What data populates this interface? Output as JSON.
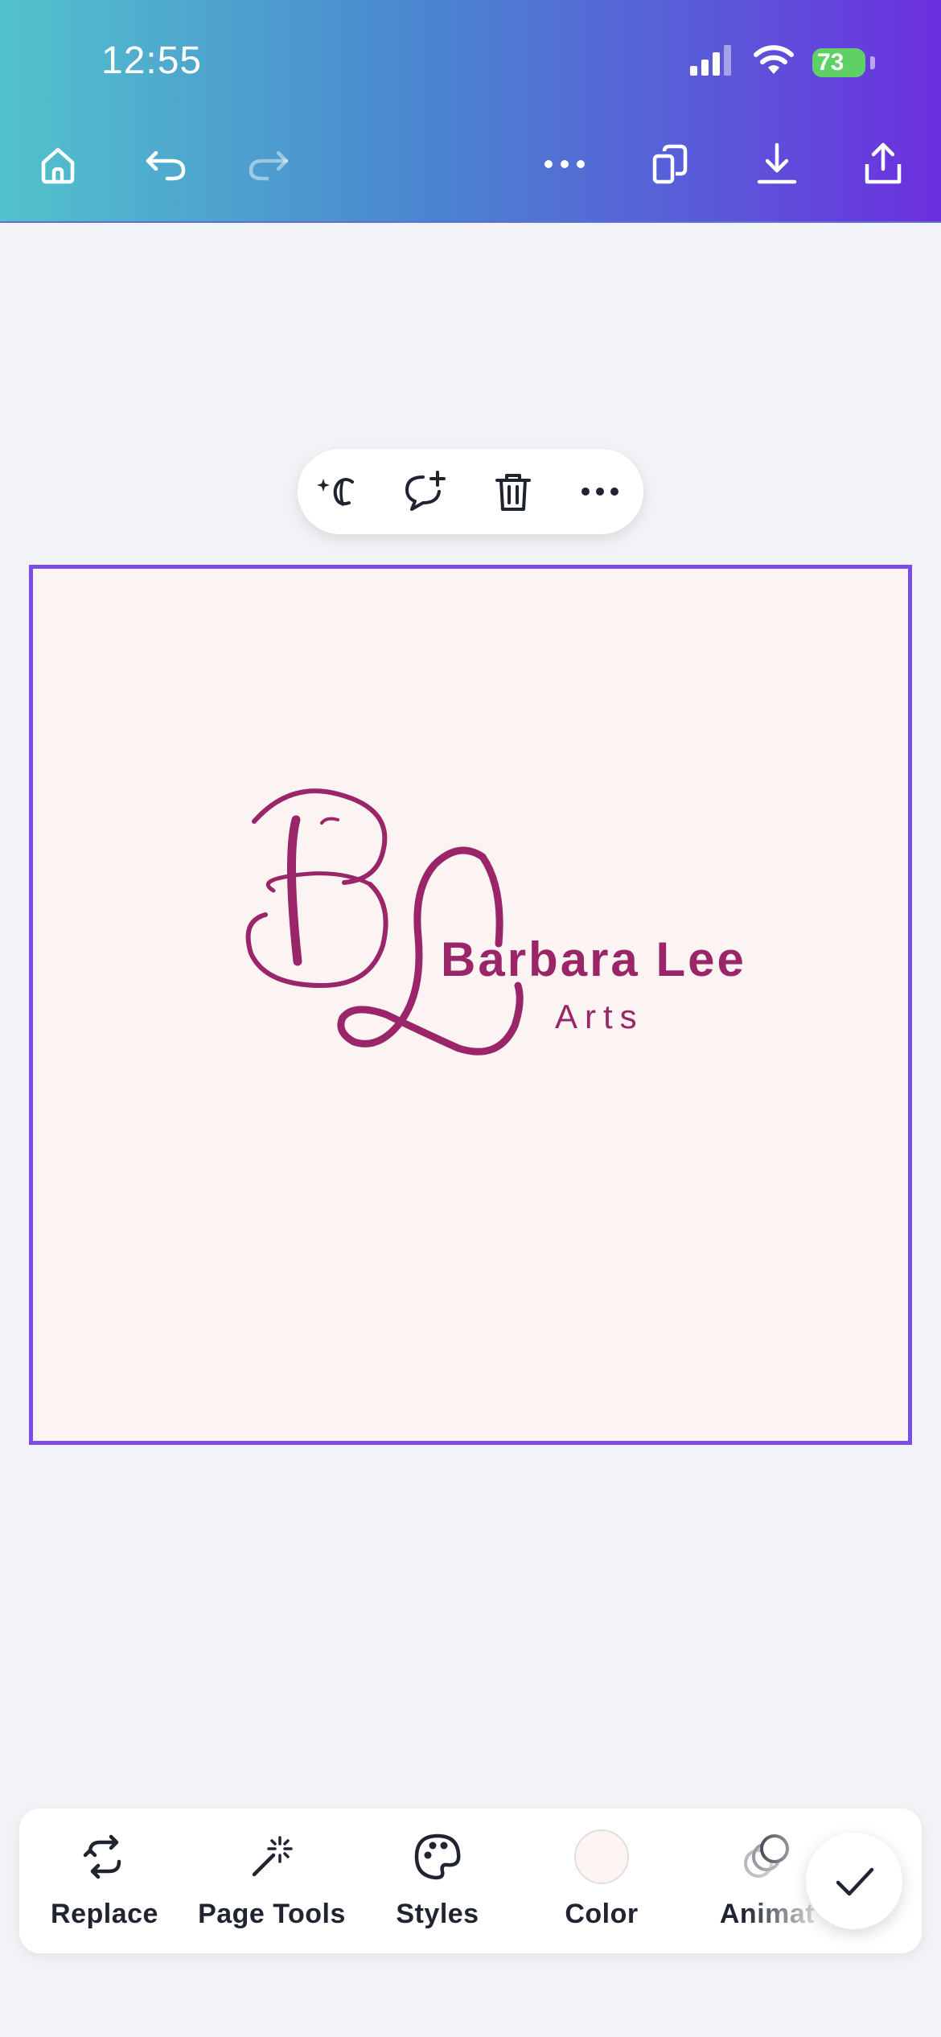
{
  "status_bar": {
    "time": "12:55",
    "battery_percent": "73"
  },
  "top_toolbar": {
    "icons": [
      "home-icon",
      "undo-icon",
      "redo-icon",
      "more-icon",
      "copy-pages-icon",
      "download-icon",
      "share-icon"
    ]
  },
  "floating_toolbar": {
    "icons": [
      "magic-edit-icon",
      "add-comment-icon",
      "delete-icon",
      "more-icon"
    ]
  },
  "design": {
    "background_color": "#fcf4f2",
    "brand_color": "#9a2568",
    "monogram": "BL",
    "name": "Barbara Lee",
    "subtitle": "Arts"
  },
  "bottom_toolbar": {
    "items": [
      {
        "label": "Replace",
        "icon": "replace-icon"
      },
      {
        "label": "Page Tools",
        "icon": "magic-wand-icon"
      },
      {
        "label": "Styles",
        "icon": "palette-icon"
      },
      {
        "label": "Color",
        "icon": "color-swatch"
      },
      {
        "label": "Animat",
        "icon": "animate-icon"
      }
    ],
    "done_icon": "checkmark-icon"
  },
  "colors": {
    "accent": "#7d4ce6",
    "selection_border": "#7d4ce6",
    "text_dark": "#1f2430"
  }
}
